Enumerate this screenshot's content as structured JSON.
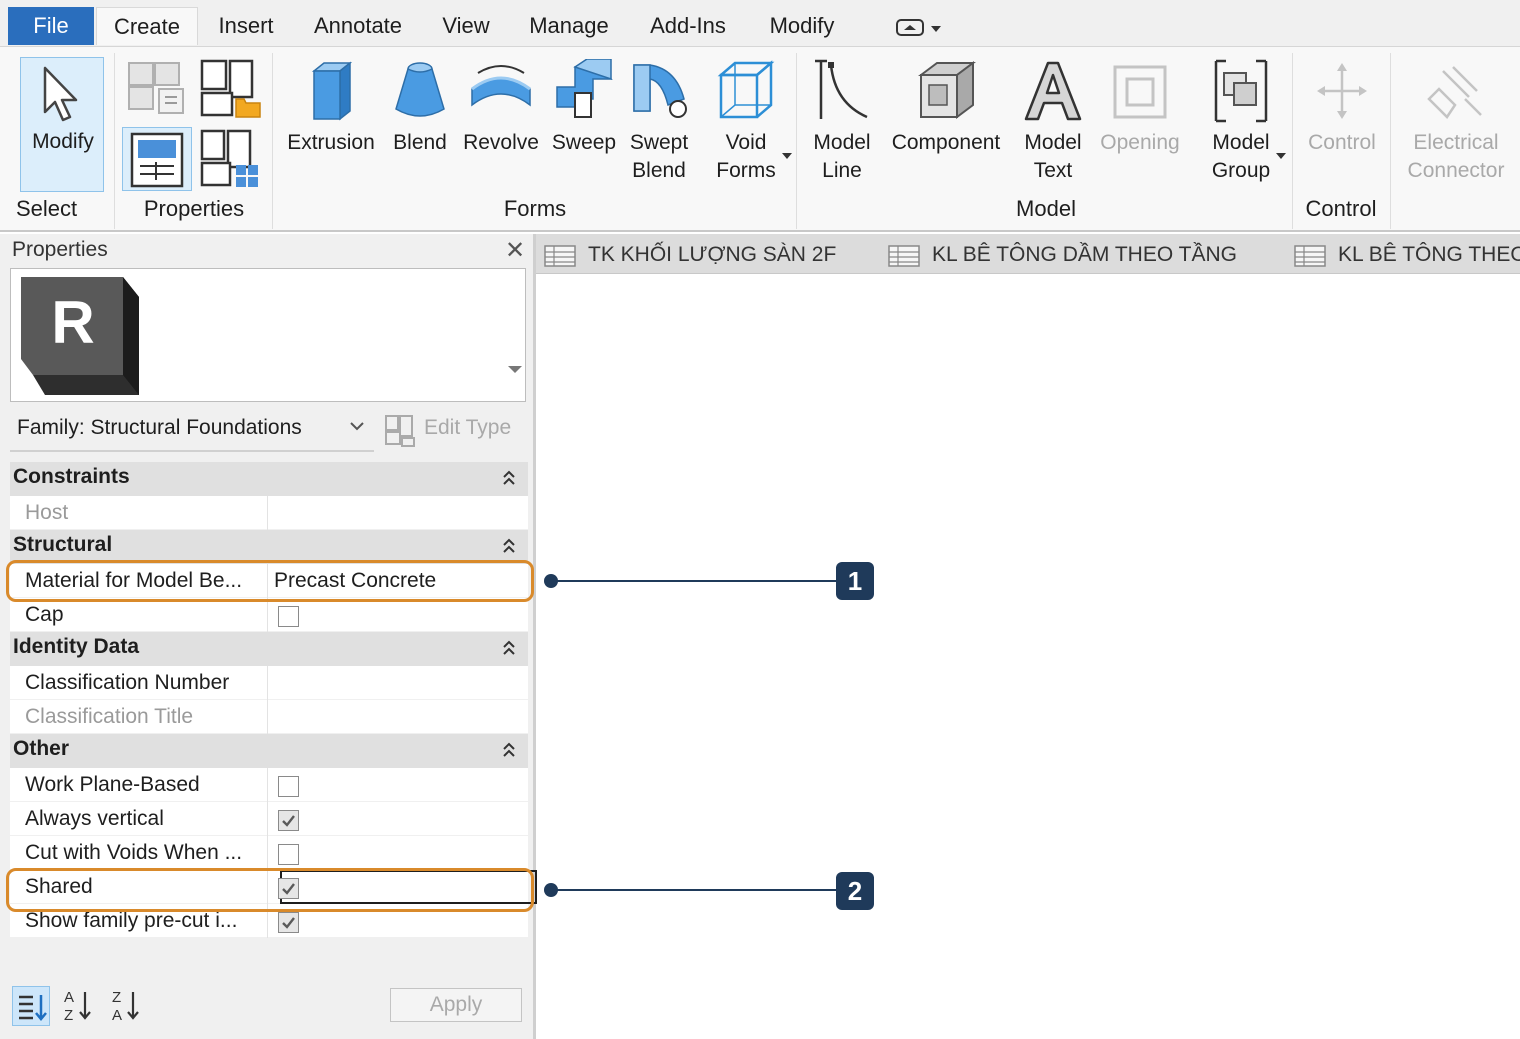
{
  "menu": {
    "file": "File",
    "create": "Create",
    "insert": "Insert",
    "annotate": "Annotate",
    "view": "View",
    "manage": "Manage",
    "addins": "Add-Ins",
    "modify": "Modify"
  },
  "ribbon": {
    "modify": "Modify",
    "select": "Select",
    "properties": "Properties",
    "extrusion": "Extrusion",
    "blend": "Blend",
    "revolve": "Revolve",
    "sweep": "Sweep",
    "swept_blend_1": "Swept",
    "swept_blend_2": "Blend",
    "void_forms_1": "Void",
    "void_forms_2": "Forms",
    "forms_panel": "Forms",
    "model_line_1": "Model",
    "model_line_2": "Line",
    "component": "Component",
    "model_text_1": "Model",
    "model_text_2": "Text",
    "opening": "Opening",
    "model_group_1": "Model",
    "model_group_2": "Group",
    "model_panel": "Model",
    "control": "Control",
    "control_panel": "Control",
    "electrical_connector_1": "Electrical",
    "electrical_connector_2": "Connector"
  },
  "properties": {
    "title": "Properties",
    "preview_letter": "R",
    "family_selector": "Family: Structural Foundations",
    "edit_type": "Edit Type",
    "apply": "Apply",
    "groups": {
      "constraints": "Constraints",
      "structural": "Structural",
      "identity": "Identity Data",
      "other": "Other"
    },
    "params": {
      "host": "Host",
      "material": "Material for Model Be...",
      "material_value": "Precast Concrete",
      "cap": "Cap",
      "classification_number": "Classification Number",
      "classification_title": "Classification Title",
      "work_plane_based": "Work Plane-Based",
      "always_vertical": "Always vertical",
      "cut_with_voids": "Cut with Voids When ...",
      "shared": "Shared",
      "show_precut": "Show family pre-cut i..."
    },
    "checked": {
      "cap": false,
      "work_plane_based": false,
      "always_vertical": true,
      "cut_with_voids": false,
      "shared": true,
      "show_precut": true
    }
  },
  "tabs": [
    "TK KHỐI LƯỢNG SÀN 2F",
    "KL BÊ TÔNG DẦM THEO TẦNG",
    "KL BÊ TÔNG THEO"
  ],
  "callouts": [
    "1",
    "2"
  ],
  "colors": {
    "accent_blue": "#2a6ebd",
    "highlight_orange": "#d98a2b",
    "callout_navy": "#1f3a5a"
  }
}
